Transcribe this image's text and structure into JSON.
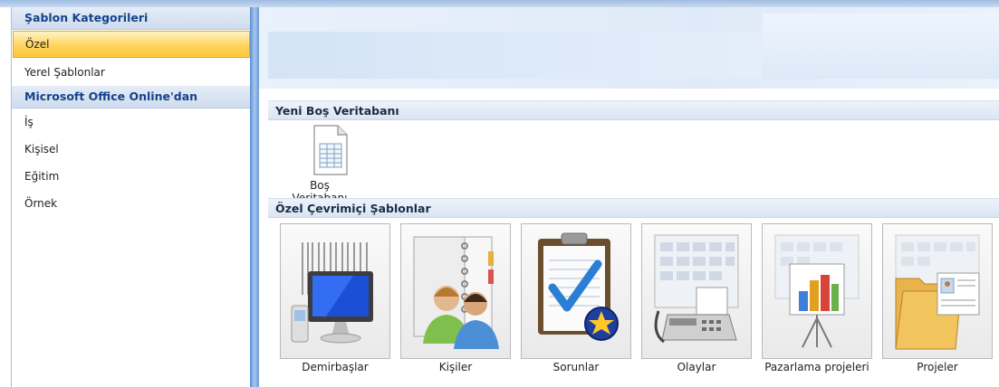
{
  "sidebar": {
    "header_categories": "Şablon Kategorileri",
    "items_top": [
      "Özel",
      "Yerel Şablonlar"
    ],
    "header_online": "Microsoft Office Online'dan",
    "items_online": [
      "İş",
      "Kişisel",
      "Eğitim",
      "Örnek"
    ],
    "selected_index": 0
  },
  "sections": {
    "new_blank": "Yeni Boş Veritabanı",
    "featured_online": "Özel Çevrimiçi Şablonlar"
  },
  "blank_database": {
    "label": "Boş Veritabanı",
    "icon": "blank-database-icon"
  },
  "templates": [
    {
      "label": "Demirbaşlar",
      "icon": "assets-icon"
    },
    {
      "label": "Kişiler",
      "icon": "contacts-icon"
    },
    {
      "label": "Sorunlar",
      "icon": "issues-icon"
    },
    {
      "label": "Olaylar",
      "icon": "events-icon"
    },
    {
      "label": "Pazarlama projeleri",
      "icon": "marketing-projects-icon"
    },
    {
      "label": "Projeler",
      "icon": "projects-icon"
    }
  ],
  "colors": {
    "selection": "#ffd35e",
    "header_text": "#15428b",
    "divider": "#5b8ed4"
  }
}
